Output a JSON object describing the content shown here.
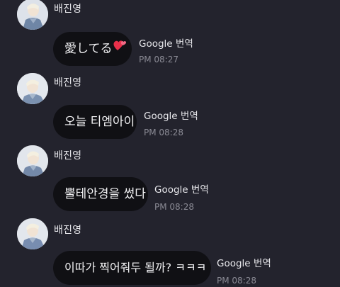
{
  "messages": [
    {
      "sender": "배진영",
      "text": "愛してる",
      "emoji": "two-hearts",
      "translate_label": "Google 번역",
      "time": "PM 08:27"
    },
    {
      "sender": "배진영",
      "text": "오늘 티엠아이",
      "translate_label": "Google 번역",
      "time": "PM 08:28"
    },
    {
      "sender": "배진영",
      "text": "뿔테안경을 썼다",
      "translate_label": "Google 번역",
      "time": "PM 08:28"
    },
    {
      "sender": "배진영",
      "text": "이따가 찍어줘두 될까? ㅋㅋㅋ",
      "translate_label": "Google 번역",
      "time": "PM 08:28"
    }
  ],
  "colors": {
    "background": "#23232d",
    "bubble": "#101014",
    "heart": "#e8304a"
  }
}
